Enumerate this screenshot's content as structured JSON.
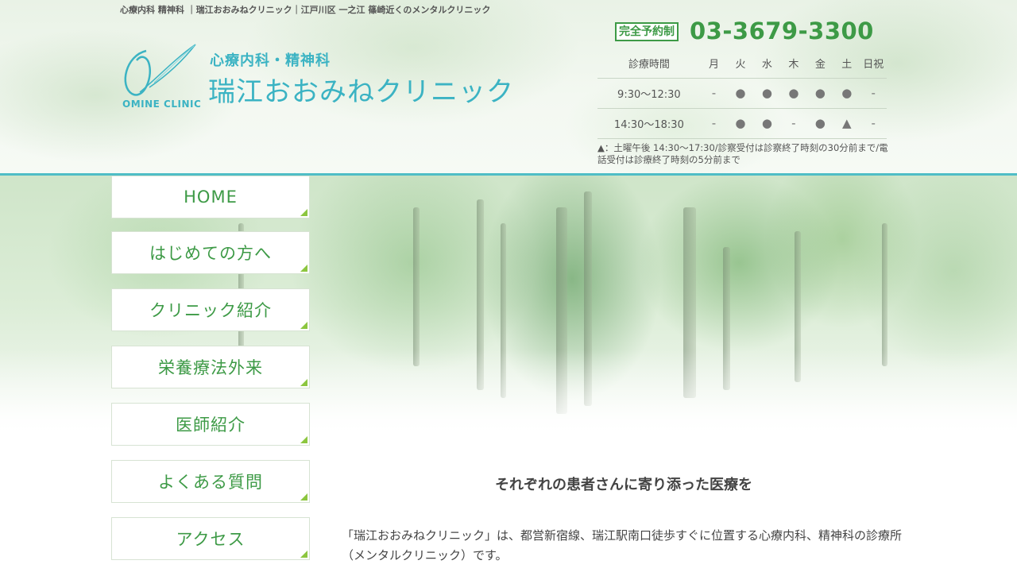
{
  "top_tagline": "心療内科 精神科 ｜瑞江おおみねクリニック｜江戸川区 一之江 篠崎近くのメンタルクリニック",
  "logo": {
    "subtitle": "心療内科・精神科",
    "name": "瑞江おおみねクリニック",
    "english": "OMINE CLINIC"
  },
  "contact": {
    "reserve_label": "完全予約制",
    "phone": "03-3679-3300"
  },
  "schedule": {
    "header": [
      "診療時間",
      "月",
      "火",
      "水",
      "木",
      "金",
      "土",
      "日祝"
    ],
    "rows": [
      [
        "9:30〜12:30",
        "-",
        "●",
        "●",
        "●",
        "●",
        "●",
        "-"
      ],
      [
        "14:30〜18:30",
        "-",
        "●",
        "●",
        "-",
        "●",
        "▲",
        "-"
      ]
    ],
    "note": "▲：土曜午後 14:30〜17:30/診察受付は診察終了時刻の30分前まで/電話受付は診療終了時刻の5分前まで"
  },
  "nav": [
    {
      "label": "HOME"
    },
    {
      "label": "はじめての方へ"
    },
    {
      "label": "クリニック紹介"
    },
    {
      "label": "栄養療法外来"
    },
    {
      "label": "医師紹介"
    },
    {
      "label": "よくある質問"
    },
    {
      "label": "アクセス"
    }
  ],
  "main": {
    "lead": "それぞれの患者さんに寄り添った医療を",
    "intro": "「瑞江おおみねクリニック」は、都営新宿線、瑞江駅南口徒歩すぐに位置する心療内科、精神科の診療所（メンタルクリニック）です。"
  },
  "colors": {
    "brand_teal": "#3bb3c3",
    "brand_green": "#3d9a46",
    "accent_lime": "#8cc63f"
  }
}
